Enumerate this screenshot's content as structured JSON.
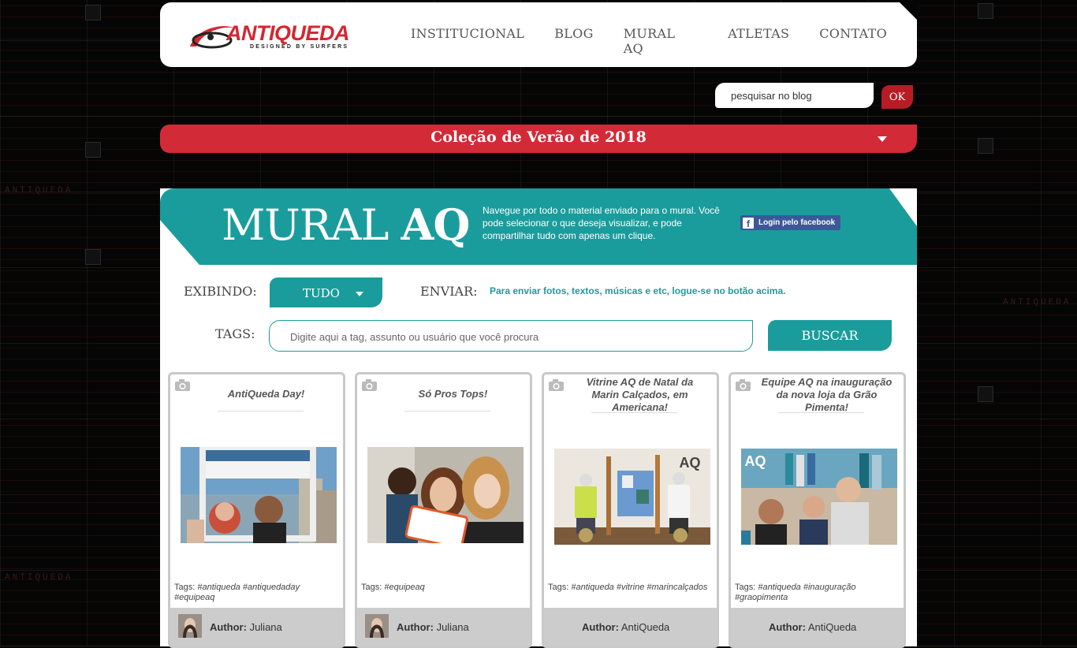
{
  "background": {
    "watermark": "ANTIQUEDA"
  },
  "header": {
    "logo_text": "ANTIQUEDA",
    "logo_sub": "DESIGNED BY SURFERS",
    "nav": [
      "INSTITUCIONAL",
      "BLOG",
      "MURAL AQ",
      "ATLETAS",
      "CONTATO"
    ]
  },
  "search": {
    "placeholder": "pesquisar no blog",
    "button": "OK"
  },
  "collection": {
    "title": "Coleção de Verão de 2018",
    "icon": "caret-down-icon"
  },
  "mural": {
    "title_light": "MURAL",
    "title_bold": "AQ",
    "description": "Navegue por todo o material enviado para o mural. Você pode selecionar o que deseja visualizar, e pode compartilhar tudo com apenas um clique.",
    "facebook_button": "Login pelo facebook"
  },
  "filters": {
    "exibindo_label": "EXIBINDO:",
    "exibindo_value": "TUDO",
    "enviar_label": "ENVIAR:",
    "enviar_text": "Para enviar fotos, textos, músicas e etc, logue-se no botão acima.",
    "tags_label": "TAGS:",
    "tags_placeholder": "Digite aqui a tag, assunto ou usuário que você procura",
    "buscar_button": "BUSCAR"
  },
  "cards": [
    {
      "title": "AntiQueda Day!",
      "tags_label": "Tags:",
      "tags": "#antiqueda #antiquedaday #equipeaq",
      "author_label": "Author:",
      "author": "Juliana",
      "avatar": true,
      "photo": "instagram-frame-photo"
    },
    {
      "title": "Só Pros Tops!",
      "tags_label": "Tags:",
      "tags": "#equipeaq",
      "author_label": "Author:",
      "author": "Juliana",
      "avatar": true,
      "photo": "selfie-photo"
    },
    {
      "title": "Vitrine AQ de Natal da Marin Calçados, em Americana!",
      "tags_label": "Tags:",
      "tags": "#antiqueda #vitrine #marincalçados",
      "author_label": "Author:",
      "author": "AntiQueda",
      "avatar": false,
      "photo": "store-window-photo"
    },
    {
      "title": "Equipe AQ na inauguração da nova loja da Grão Pimenta!",
      "tags_label": "Tags:",
      "tags": "#antiqueda #inauguração #graopimenta",
      "author_label": "Author:",
      "author": "AntiQueda",
      "avatar": false,
      "photo": "store-opening-photo"
    }
  ],
  "colors": {
    "teal": "#1b9c9c",
    "red": "#d32a37",
    "dark_red": "#b71c25"
  }
}
